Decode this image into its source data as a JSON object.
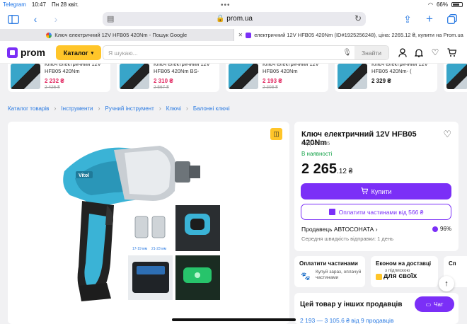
{
  "status": {
    "carrier": "Telegram",
    "time": "10:47",
    "date": "Пн 28 квіт.",
    "battery": "66%"
  },
  "browser": {
    "url": "prom.ua",
    "tabs": [
      {
        "title": "Ключ електричний 12V HFB05 420Nm - Пошук Google"
      },
      {
        "title": "електричний 12V HFB05 420Nm (ID#1925256248), ціна: 2265.12 ₴, купити на Prom.ua"
      }
    ]
  },
  "header": {
    "logo": "prom",
    "catalog_label": "Каталог",
    "search_placeholder": "Я шукаю...",
    "search_button": "Знайти"
  },
  "recommended": [
    {
      "name": "Ключ електричний 12V HFB05 420Nm",
      "price": "2 232 ₴",
      "old_price": "2 426 ₴"
    },
    {
      "name": "Ключ електричний 12V HFB05 420Nm BS-",
      "price": "2 310 ₴",
      "old_price": "2 567 ₴"
    },
    {
      "name": "Ключ електричний 12V HFB05 420Nm",
      "price": "2 193 ₴",
      "old_price": "2 308 ₴"
    },
    {
      "name": "Ключ електричний 12V HFB05 420Nm- (",
      "price": "2 329 ₴",
      "old_price": ""
    }
  ],
  "breadcrumb": [
    "Каталог товарів",
    "Інструменти",
    "Ручний інструмент",
    "Ключі",
    "Балонні ключі"
  ],
  "product": {
    "title": "Ключ електричний 12V HFB05 420Nm",
    "code": "Код: HFB05",
    "stock": "В наявності",
    "price_main": "2 265",
    "price_cents": ".12 ₴",
    "buy_label": "Купити",
    "parts_label": "Оплатити частинами від 566 ₴",
    "seller": "Продавець АВТОСОНАТА",
    "rating": "96%",
    "speed": "Середня швидкість відправки: 1 день",
    "image_labels": {
      "brand": "Vitol",
      "socket_small": "17-19 мм",
      "socket_large": "21-23 мм"
    }
  },
  "promos": [
    {
      "title": "Оплатити частинами",
      "sub": "Купуй зараз, оплачуй частинами"
    },
    {
      "title": "Економ на доставці",
      "sub": "з підпискою",
      "brand": "для своїх"
    },
    {
      "title": "Сп"
    }
  ],
  "others": {
    "heading": "Цей товар у інших продавців",
    "range": "2 193 — 3 105.6 ₴ від 9 продавців"
  },
  "chat_label": "Чат",
  "colors": {
    "accent": "#7b2ff7",
    "brand_yellow": "#ffc529",
    "price_red": "#e0225c",
    "link": "#2a7ae2"
  }
}
